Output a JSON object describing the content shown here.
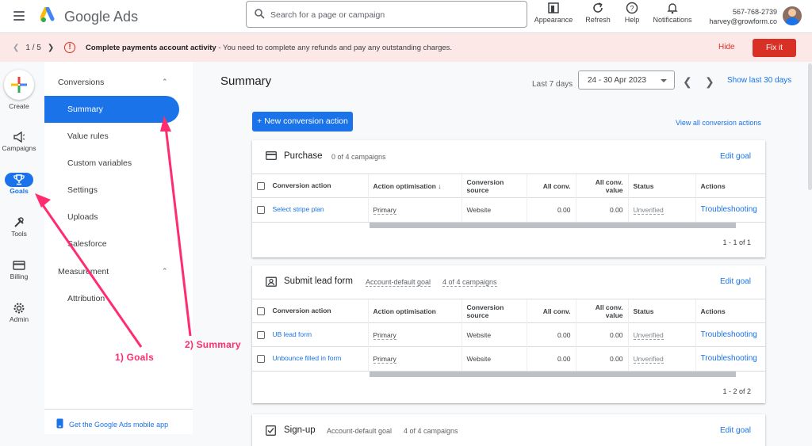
{
  "topbar": {
    "product": "Google Ads",
    "search_placeholder": "Search for a page or campaign",
    "buttons": [
      {
        "label": "Appearance",
        "icon": "appearance-icon"
      },
      {
        "label": "Refresh",
        "icon": "refresh-icon"
      },
      {
        "label": "Help",
        "icon": "help-icon"
      },
      {
        "label": "Notifications",
        "icon": "bell-icon"
      }
    ],
    "account_id": "567-768-2739",
    "account_email": "harvey@growform.co"
  },
  "alert": {
    "pager": "1 / 5",
    "title": "Complete payments account activity",
    "message": " - You need to complete any refunds and pay any outstanding charges.",
    "hide": "Hide",
    "fix": "Fix it"
  },
  "rail": {
    "create": "Create",
    "items": [
      {
        "label": "Campaigns",
        "icon": "megaphone-icon"
      },
      {
        "label": "Goals",
        "icon": "trophy-icon",
        "active": true
      },
      {
        "label": "Tools",
        "icon": "tools-icon"
      },
      {
        "label": "Billing",
        "icon": "credit-card-icon"
      },
      {
        "label": "Admin",
        "icon": "gear-icon"
      }
    ]
  },
  "sidebar": {
    "group1": "Conversions",
    "items1": [
      "Summary",
      "Value rules",
      "Custom variables",
      "Settings",
      "Uploads",
      "Salesforce"
    ],
    "group2": "Measurement",
    "items2": [
      "Attribution"
    ],
    "mobile": "Get the Google Ads mobile app"
  },
  "main": {
    "title": "Summary",
    "range_label": "Last 7 days",
    "date_range": "24 - 30 Apr 2023",
    "show_last": "Show last 30 days",
    "new_button": "+ New conversion action",
    "view_all": "View all conversion actions"
  },
  "columns": [
    "Conversion action",
    "Action optimisation",
    "Conversion source",
    "All conv.",
    "All conv. value",
    "Status",
    "Actions"
  ],
  "goals": [
    {
      "title": "Purchase",
      "meta1": "0 of 4 campaigns",
      "edit": "Edit goal",
      "rows": [
        {
          "name": "Select stripe plan",
          "opt": "Primary",
          "source": "Website",
          "conv": "0.00",
          "value": "0.00",
          "status": "Unverified",
          "action": "Troubleshooting"
        }
      ],
      "pager": "1 - 1 of 1"
    },
    {
      "title": "Submit lead form",
      "meta1": "Account-default goal",
      "meta2": "4 of 4 campaigns",
      "edit": "Edit goal",
      "rows": [
        {
          "name": "UB lead form",
          "opt": "Primary",
          "source": "Website",
          "conv": "0.00",
          "value": "0.00",
          "status": "Unverified",
          "action": "Troubleshooting"
        },
        {
          "name": "Unbounce filled in form",
          "opt": "Primary",
          "source": "Website",
          "conv": "0.00",
          "value": "0.00",
          "status": "Unverified",
          "action": "Troubleshooting"
        }
      ],
      "pager": "1 - 2 of 2"
    },
    {
      "title": "Sign-up",
      "meta1": "Account-default goal",
      "meta2": "4 of 4 campaigns",
      "edit": "Edit goal"
    }
  ],
  "annotations": {
    "goals": "1) Goals",
    "summary": "2) Summary",
    "color": "#ff2d6f"
  }
}
